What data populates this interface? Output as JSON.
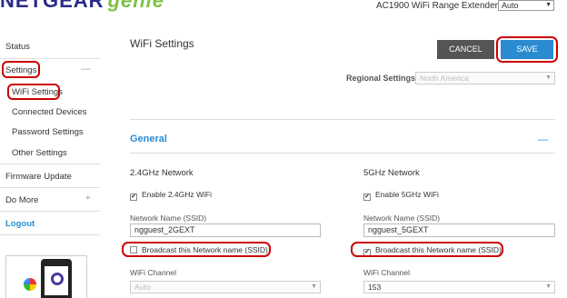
{
  "header": {
    "logo_brand": "NETGEAR",
    "logo_product": "genie",
    "model": "AC1900 WiFi Range Extender",
    "language_value": "Auto"
  },
  "sidebar": {
    "status": "Status",
    "settings": "Settings",
    "wifi_settings": "WiFi Settings",
    "connected_devices": "Connected Devices",
    "password_settings": "Password Settings",
    "other_settings": "Other Settings",
    "firmware_update": "Firmware Update",
    "do_more": "Do More",
    "logout": "Logout",
    "collapse_symbol": "—",
    "expand_symbol": "+"
  },
  "main": {
    "title": "WiFi Settings",
    "cancel_label": "CANCEL",
    "save_label": "SAVE",
    "regional_label": "Regional Settings:",
    "regional_value": "North America",
    "section_title": "General",
    "section_toggle": "—",
    "networks": {
      "g24": {
        "heading": "2.4GHz Network",
        "enable_label": "Enable 2.4GHz WiFi",
        "enable_checked": true,
        "ssid_label": "Network Name (SSID)",
        "ssid_value": "ngguest_2GEXT",
        "broadcast_label": "Broadcast this Network name (SSID)",
        "broadcast_checked": false,
        "channel_label": "WiFi Channel",
        "channel_value": "Auto"
      },
      "g5": {
        "heading": "5GHz Network",
        "enable_label": "Enable 5GHz WiFi",
        "enable_checked": true,
        "ssid_label": "Network Name (SSID)",
        "ssid_value": "ngguest_5GEXT",
        "broadcast_label": "Broadcast this Network name (SSID)",
        "broadcast_checked": true,
        "channel_label": "WiFi Channel",
        "channel_value": "153"
      }
    }
  },
  "symbols": {
    "check": "✔",
    "dropdown": "▼"
  },
  "colors": {
    "accent": "#2a8bd1",
    "annotation": "#cc0000",
    "brand": "#2a2a8a",
    "genie": "#7cc242"
  }
}
